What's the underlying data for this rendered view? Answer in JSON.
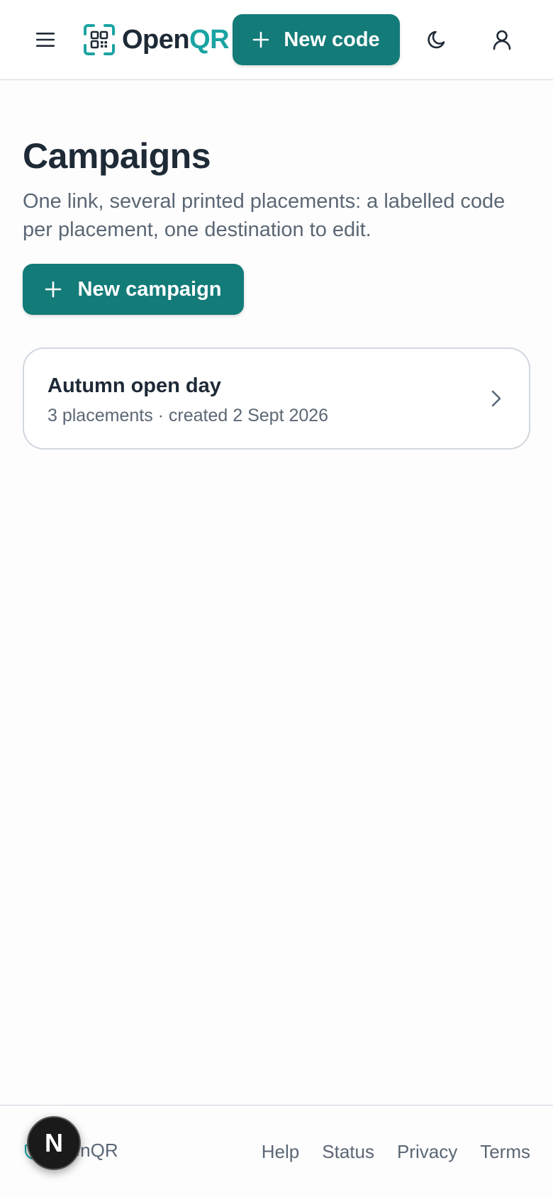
{
  "header": {
    "logo_prefix": "Open",
    "logo_suffix": "QR",
    "new_code_label": "New code",
    "brand_color": "#137b78",
    "accent_color": "#1aa3a3",
    "icons": [
      "menu-icon",
      "qr-logo-icon",
      "plus-icon",
      "moon-icon",
      "user-icon"
    ]
  },
  "main": {
    "title": "Campaigns",
    "subtitle": "One link, several printed placements: a labelled code per placement, one destination to edit.",
    "new_campaign_label": "New campaign",
    "campaigns": [
      {
        "name": "Autumn open day",
        "meta": "3 placements · created 2 Sept 2026"
      }
    ]
  },
  "footer": {
    "brand": "OpenQR",
    "links": [
      "Help",
      "Status",
      "Privacy",
      "Terms"
    ],
    "badge_letter": "N"
  }
}
